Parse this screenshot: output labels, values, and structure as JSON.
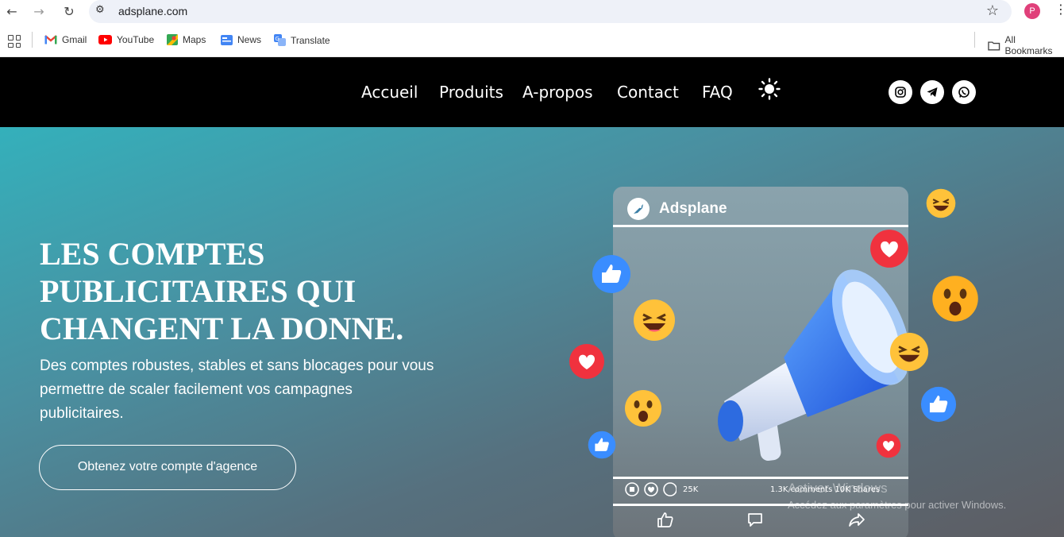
{
  "browser": {
    "url": "adsplane.com",
    "profile_initial": "P",
    "bookmarks": [
      "Gmail",
      "YouTube",
      "Maps",
      "News",
      "Translate"
    ],
    "all_bookmarks": "All Bookmarks"
  },
  "nav": {
    "menu": [
      "Accueil",
      "Produits",
      "A-propos",
      "Contact",
      "FAQ"
    ],
    "theme_toggle_icon": "sun-icon",
    "socials": [
      "instagram-icon",
      "telegram-icon",
      "whatsapp-icon"
    ]
  },
  "hero": {
    "title": "LES COMPTES PUBLICITAIRES QUI CHANGENT LA DONNE.",
    "subtitle": "Des comptes robustes, stables et sans blocages pour vous permettre de scaler facilement vos campagnes publicitaires.",
    "cta": "Obtenez votre compte d'agence"
  },
  "post_card": {
    "brand": "Adsplane",
    "reactions_count": "25K",
    "comments_shares": "1.3K comments  10K Shares"
  },
  "watermark": {
    "line1": "Activer Windows",
    "line2": "Accédez aux paramètres pour activer Windows."
  },
  "colors": {
    "header_bg": "#000000",
    "hero_start": "#34b0bb",
    "hero_end": "#5d5d63"
  }
}
